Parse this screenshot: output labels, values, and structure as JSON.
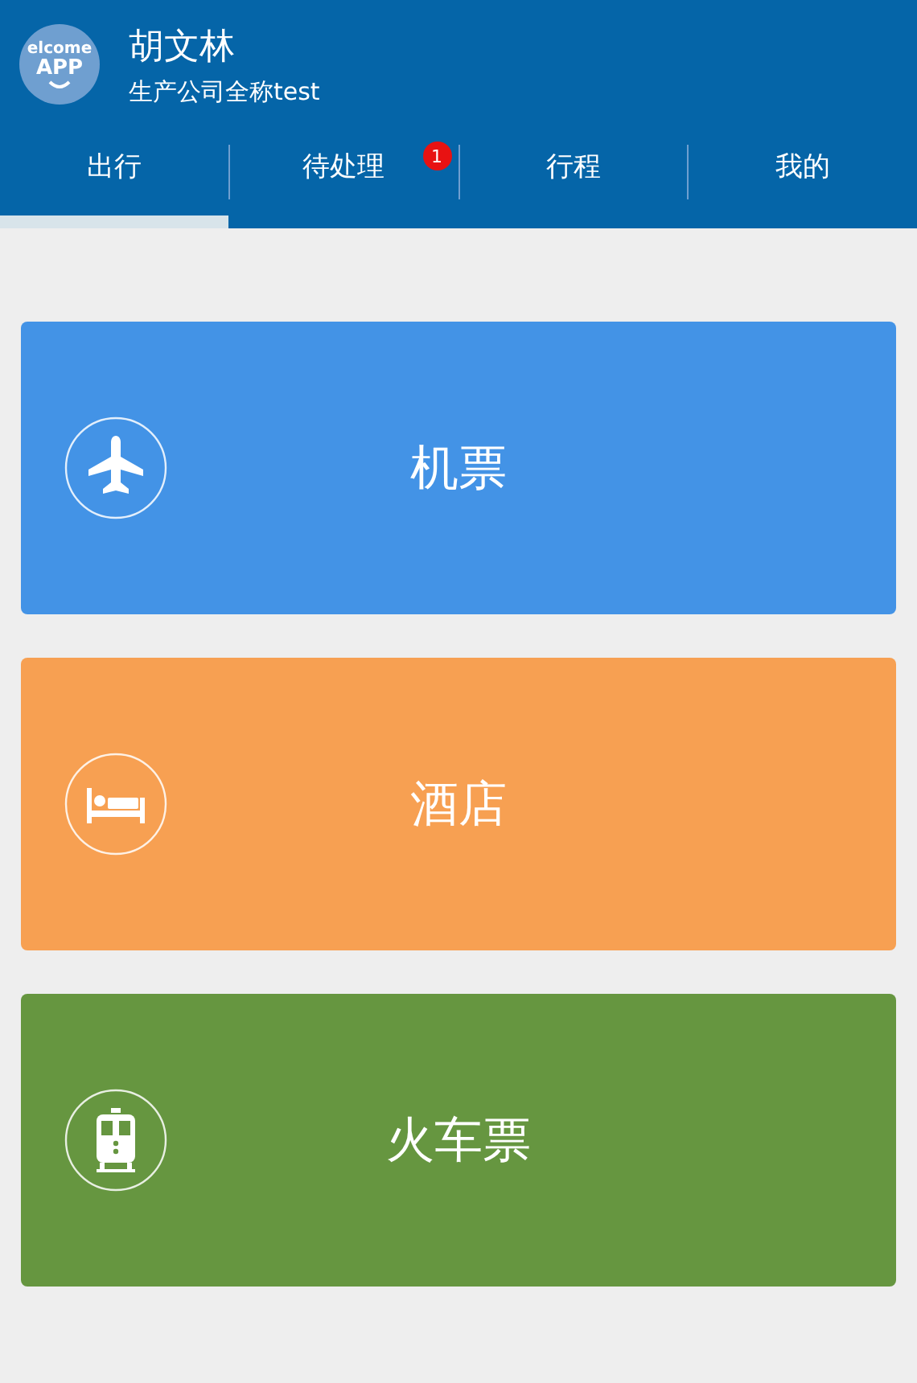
{
  "header": {
    "avatar": {
      "lines": [
        "elcome",
        "APP"
      ]
    },
    "name": "胡文林",
    "company": "生产公司全称test"
  },
  "tabs": [
    {
      "label": "出行",
      "selected": true
    },
    {
      "label": "待处理",
      "selected": false,
      "badge": "1"
    },
    {
      "label": "行程",
      "selected": false
    },
    {
      "label": "我的",
      "selected": false
    }
  ],
  "cards": [
    {
      "label": "机票",
      "kind": "plane",
      "color": "#4393e6"
    },
    {
      "label": "酒店",
      "kind": "bed",
      "color": "#f7a052"
    },
    {
      "label": "火车票",
      "kind": "train",
      "color": "#669640"
    }
  ]
}
